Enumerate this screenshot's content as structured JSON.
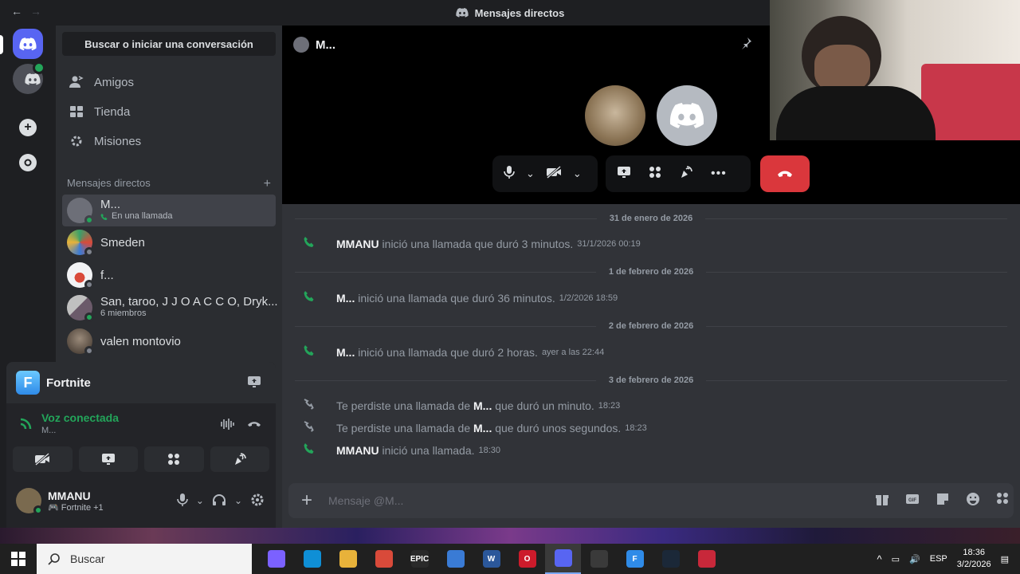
{
  "titlebar": {
    "title": "Mensajes directos",
    "back": "←",
    "forward": "→"
  },
  "sidebar": {
    "search_label": "Buscar o iniciar una conversación",
    "nav": [
      {
        "label": "Amigos",
        "icon": "friends-icon"
      },
      {
        "label": "Tienda",
        "icon": "shop-icon"
      },
      {
        "label": "Misiones",
        "icon": "quests-icon"
      }
    ],
    "dm_header": "Mensajes directos",
    "dm_add": "+",
    "dms": [
      {
        "name": "M...",
        "sub": "En una llamada",
        "color": "#6d6f78",
        "status": "#23a55a",
        "active": true
      },
      {
        "name": "Smeden",
        "sub": "",
        "color": "#3aa06a",
        "status": "#80848e",
        "active": false
      },
      {
        "name": "f...",
        "sub": "",
        "color": "#e8e8e8",
        "status": "#80848e",
        "active": false
      },
      {
        "name": "San, taroo, J J O A C C O, Dryk...",
        "sub": "6 miembros",
        "color": "#8a8a8a",
        "status": "",
        "active": false
      },
      {
        "name": "valen montovio",
        "sub": "",
        "color": "#5a5048",
        "status": "#80848e",
        "active": false
      }
    ]
  },
  "voice_panel": {
    "game_name": "Fortnite",
    "game_icon_letter": "F",
    "status_title": "Voz conectada",
    "status_sub": "M...",
    "user_name": "MMANU",
    "user_activity": "Fortnite +1"
  },
  "call": {
    "channel_name": "M..."
  },
  "messages": {
    "rows": [
      {
        "kind": "divider",
        "text": "31 de enero de 2026"
      },
      {
        "kind": "call",
        "missed": false,
        "pre": "",
        "name": "MMANU",
        "post": " inició una llamada que duró 3 minutos.",
        "time": "31/1/2026 00:19"
      },
      {
        "kind": "divider",
        "text": "1 de febrero de 2026"
      },
      {
        "kind": "call",
        "missed": false,
        "pre": "",
        "name": "M...",
        "post": " inició una llamada que duró 36 minutos.",
        "time": "1/2/2026 18:59"
      },
      {
        "kind": "divider",
        "text": "2 de febrero de 2026"
      },
      {
        "kind": "call",
        "missed": false,
        "pre": "",
        "name": "M...",
        "post": " inició una llamada que duró 2 horas.",
        "time": "ayer a las 22:44"
      },
      {
        "kind": "divider",
        "text": "3 de febrero de 2026"
      },
      {
        "kind": "call",
        "missed": true,
        "pre": "Te perdiste una llamada de ",
        "name": "M...",
        "post": " que duró un minuto.",
        "time": "18:23"
      },
      {
        "kind": "call",
        "missed": true,
        "pre": "Te perdiste una llamada de ",
        "name": "M...",
        "post": " que duró unos segundos.",
        "time": "18:23"
      },
      {
        "kind": "call",
        "missed": false,
        "pre": "",
        "name": "MMANU",
        "post": " inició una llamada.",
        "time": "18:30"
      }
    ]
  },
  "composer": {
    "placeholder": "Mensaje @M...",
    "plus": "+"
  },
  "taskbar": {
    "search": "Buscar",
    "lang": "ESP",
    "time": "18:36",
    "date": "3/2/2026",
    "apps": [
      {
        "name": "copilot-app",
        "color": "#7b61ff",
        "label": ""
      },
      {
        "name": "edge-app",
        "color": "#0f8fd6",
        "label": ""
      },
      {
        "name": "explorer-app",
        "color": "#e8b23a",
        "label": ""
      },
      {
        "name": "chrome-app",
        "color": "#d94a3a",
        "label": ""
      },
      {
        "name": "epic-games-app",
        "color": "#2a2a2a",
        "label": "EPIC"
      },
      {
        "name": "calculator-app",
        "color": "#3a7bd5",
        "label": ""
      },
      {
        "name": "word-app",
        "color": "#2b579a",
        "label": "W"
      },
      {
        "name": "opera-app",
        "color": "#cc1b2b",
        "label": "O"
      },
      {
        "name": "discord-app",
        "color": "#5865f2",
        "label": ""
      },
      {
        "name": "obs-app",
        "color": "#3a3a3a",
        "label": ""
      },
      {
        "name": "fortnite-app",
        "color": "#2f8be8",
        "label": "F"
      },
      {
        "name": "steam-app",
        "color": "#1b2838",
        "label": ""
      },
      {
        "name": "red-app",
        "color": "#c8283a",
        "label": ""
      }
    ]
  }
}
